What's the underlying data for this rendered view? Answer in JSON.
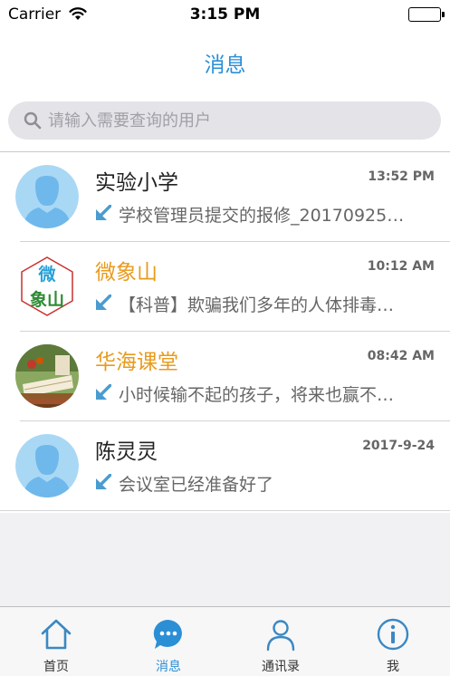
{
  "status_bar": {
    "carrier": "Carrier",
    "time": "3:15 PM"
  },
  "nav": {
    "title": "消息"
  },
  "search": {
    "placeholder": "请输入需要查询的用户"
  },
  "conversations": [
    {
      "name": "实验小学",
      "time": "13:52 PM",
      "preview": "学校管理员提交的报修_20170925…",
      "avatar": "default-person-icon",
      "name_color": "#222222"
    },
    {
      "name": "微象山",
      "time": "10:12 AM",
      "preview": "【科普】欺骗我们多年的人体排毒…",
      "avatar": "weixiangshan-logo",
      "name_color": "#e89b1d",
      "logo_text_top": "微",
      "logo_text_bottom": "象山"
    },
    {
      "name": "华海课堂",
      "time": "08:42 AM",
      "preview": "小时候输不起的孩子，将来也赢不…",
      "avatar": "books-photo",
      "name_color": "#e89b1d"
    },
    {
      "name": "陈灵灵",
      "time": "2017-9-24",
      "preview": "会议室已经准备好了",
      "avatar": "default-person-icon",
      "name_color": "#222222"
    }
  ],
  "tabs": [
    {
      "label": "首页",
      "icon": "home-icon",
      "active": false
    },
    {
      "label": "消息",
      "icon": "chat-bubble-icon",
      "active": true
    },
    {
      "label": "通讯录",
      "icon": "contacts-icon",
      "active": false
    },
    {
      "label": "我",
      "icon": "info-icon",
      "active": false
    }
  ],
  "colors": {
    "accent": "#2b8fd6",
    "highlight_name": "#e89b1d",
    "avatar_bg": "#a9d8f5"
  }
}
